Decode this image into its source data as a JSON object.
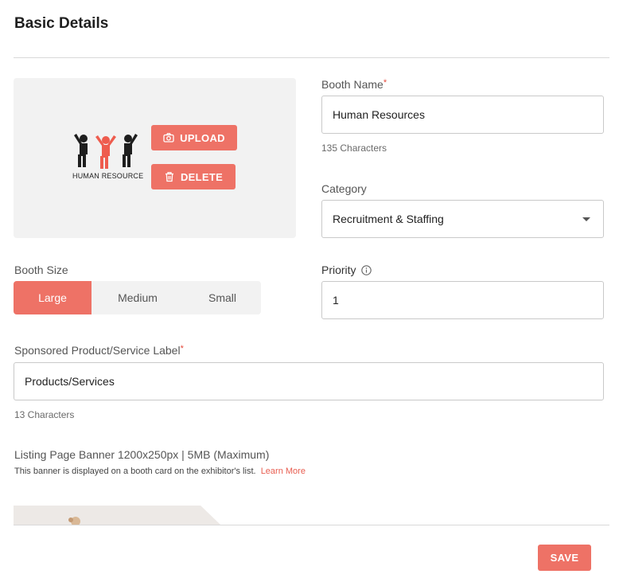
{
  "section": {
    "title": "Basic Details"
  },
  "logo": {
    "caption": "HUMAN RESOURCE",
    "upload_label": "UPLOAD",
    "delete_label": "DELETE"
  },
  "booth_name": {
    "label": "Booth Name",
    "required_mark": "*",
    "value": "Human Resources",
    "hint": "135 Characters"
  },
  "category": {
    "label": "Category",
    "selected": "Recruitment & Staffing"
  },
  "booth_size": {
    "label": "Booth Size",
    "options": [
      "Large",
      "Medium",
      "Small"
    ],
    "selected": "Large"
  },
  "priority": {
    "label": "Priority",
    "value": "1"
  },
  "sponsored_label": {
    "label": "Sponsored Product/Service Label",
    "required_mark": "*",
    "value": "Products/Services",
    "hint": "13 Characters"
  },
  "listing_banner": {
    "label": "Listing Page Banner 1200x250px | 5MB (Maximum)",
    "description": "This banner is displayed on a booth card on the exhibitor's list.",
    "learn_more": "Learn More"
  },
  "footer": {
    "save_label": "SAVE"
  },
  "colors": {
    "accent": "#ee7266",
    "required": "#e5493a"
  },
  "icons": {
    "upload": "camera-icon",
    "delete": "trash-icon",
    "priority_info": "info-icon",
    "category_dropdown": "caret-down-icon"
  }
}
